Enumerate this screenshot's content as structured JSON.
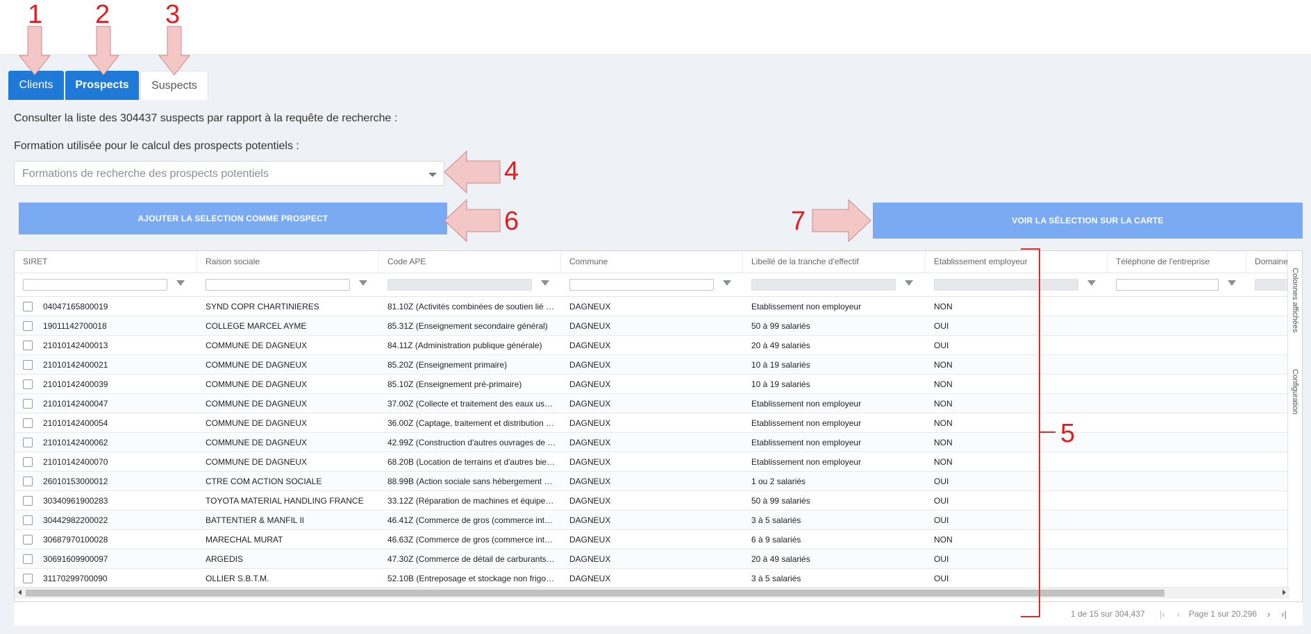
{
  "tabs": [
    {
      "label": "Clients"
    },
    {
      "label": "Prospects"
    },
    {
      "label": "Suspects"
    }
  ],
  "info_text": "Consulter la liste des 304437 suspects par rapport à la requête de recherche :",
  "formation": {
    "label": "Formation utilisée pour le calcul des prospects potentiels :",
    "placeholder": "Formations de recherche des prospects potentiels"
  },
  "buttons": {
    "add_selection": "AJOUTER LA SELECTION COMME PROSPECT",
    "view_map": "VOIR LA SÉLECTION SUR LA CARTE"
  },
  "grid": {
    "columns": [
      "SIRET",
      "Raison sociale",
      "Code APE",
      "Commune",
      "Libellé de la tranche d'effectif",
      "Etablissement employeur",
      "Téléphone de l'entreprise",
      "Domaines"
    ],
    "rows": [
      [
        "04047165800019",
        "SYND COPR CHARTINIERES",
        "81.10Z (Activités combinées de soutien lié …",
        "DAGNEUX",
        "Etablissement non employeur",
        "NON",
        ""
      ],
      [
        "19011142700018",
        "COLLEGE MARCEL AYME",
        "85.31Z (Enseignement secondaire général)",
        "DAGNEUX",
        "50 à 99 salariés",
        "OUI",
        ""
      ],
      [
        "21010142400013",
        "COMMUNE DE DAGNEUX",
        "84.11Z (Administration publique générale)",
        "DAGNEUX",
        "20 à 49 salariés",
        "OUI",
        ""
      ],
      [
        "21010142400021",
        "COMMUNE DE DAGNEUX",
        "85.20Z (Enseignement primaire)",
        "DAGNEUX",
        "10 à 19 salariés",
        "NON",
        ""
      ],
      [
        "21010142400039",
        "COMMUNE DE DAGNEUX",
        "85.10Z (Enseignement pré-primaire)",
        "DAGNEUX",
        "10 à 19 salariés",
        "NON",
        ""
      ],
      [
        "21010142400047",
        "COMMUNE DE DAGNEUX",
        "37.00Z (Collecte et traitement des eaux us…",
        "DAGNEUX",
        "Etablissement non employeur",
        "NON",
        ""
      ],
      [
        "21010142400054",
        "COMMUNE DE DAGNEUX",
        "36.00Z (Captage, traitement et distribution …",
        "DAGNEUX",
        "Etablissement non employeur",
        "NON",
        ""
      ],
      [
        "21010142400062",
        "COMMUNE DE DAGNEUX",
        "42.99Z (Construction d'autres ouvrages de …",
        "DAGNEUX",
        "Etablissement non employeur",
        "NON",
        ""
      ],
      [
        "21010142400070",
        "COMMUNE DE DAGNEUX",
        "68.20B (Location de terrains et d'autres bie…",
        "DAGNEUX",
        "Etablissement non employeur",
        "NON",
        ""
      ],
      [
        "26010153000012",
        "CTRE COM ACTION SOCIALE",
        "88.99B (Action sociale sans hébergement …",
        "DAGNEUX",
        "1 ou 2 salariés",
        "OUI",
        ""
      ],
      [
        "30340961900283",
        "TOYOTA MATERIAL HANDLING FRANCE",
        "33.12Z (Réparation de machines et équipe…",
        "DAGNEUX",
        "50 à 99 salariés",
        "OUI",
        ""
      ],
      [
        "30442982200022",
        "BATTENTIER & MANFIL II",
        "46.41Z (Commerce de gros (commerce int…",
        "DAGNEUX",
        "3 à 5 salariés",
        "OUI",
        ""
      ],
      [
        "30687970100028",
        "MARECHAL MURAT",
        "46.63Z (Commerce de gros (commerce int…",
        "DAGNEUX",
        "6 à 9 salariés",
        "NON",
        ""
      ],
      [
        "30691609900097",
        "ARGEDIS",
        "47.30Z (Commerce de détail de carburants…",
        "DAGNEUX",
        "20 à 49 salariés",
        "OUI",
        ""
      ],
      [
        "31170299700090",
        "OLLIER S.B.T.M.",
        "52.10B (Entreposage et stockage non frigo…",
        "DAGNEUX",
        "3 à 5 salariés",
        "OUI",
        ""
      ]
    ],
    "side_panel": {
      "columns_label": "Colonnes affichées",
      "config_label": "Configuration"
    }
  },
  "pager": {
    "summary": "1 de 15 sur 304,437",
    "page_info": "Page 1 sur 20,296"
  },
  "annotations": [
    "1",
    "2",
    "3",
    "4",
    "5",
    "6",
    "7"
  ],
  "colors": {
    "tab_active": "#1e7ad6",
    "button": "#7aaaf2",
    "annotation_red": "#e02020",
    "arrow_fill": "#f4c7c7"
  }
}
